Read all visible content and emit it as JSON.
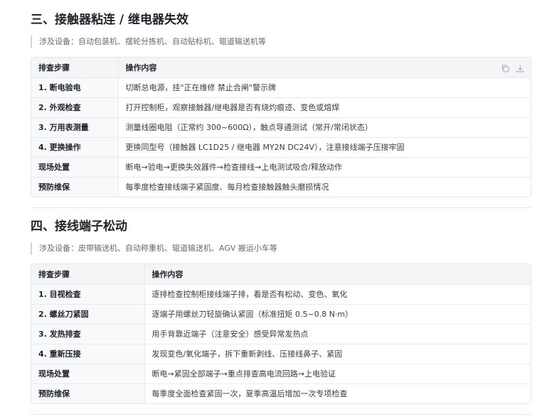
{
  "sections": [
    {
      "title": "三、接触器粘连 / 继电器失效",
      "equipment": "涉及设备：自动包装机、摆轮分拣机、自动贴标机、辊道输送机等",
      "headers": [
        "排查步骤",
        "操作内容"
      ],
      "rows": [
        {
          "step": "1. 断电验电",
          "content": "切断总电源，挂\"正在维修 禁止合闸\"警示牌"
        },
        {
          "step": "2. 外观检查",
          "content": "打开控制柜，观察接触器/继电器是否有烧灼痕迹、变色或熔焊"
        },
        {
          "step": "3. 万用表测量",
          "content": "测量线圈电阻（正常约 300~600Ω），触点导通测试（常开/常闭状态）"
        },
        {
          "step": "4. 更换操作",
          "content": "更换同型号（接触器 LC1D25 / 继电器 MY2N DC24V），注意接线端子压接牢固"
        },
        {
          "step": "现场处置",
          "content": "断电→验电→更换失效器件→检查接线→上电测试吸合/释放动作"
        },
        {
          "step": "预防维保",
          "content": "每季度检查接线端子紧固度、每月检查接触器触头磨损情况"
        }
      ]
    },
    {
      "title": "四、接线端子松动",
      "equipment": "涉及设备：皮带输送机、自动称重机、辊道输送机、AGV 搬运小车等",
      "headers": [
        "排查步骤",
        "操作内容"
      ],
      "rows": [
        {
          "step": "1. 目视检查",
          "content": "逐排检查控制柜接线端子排，看是否有松动、变色、氧化"
        },
        {
          "step": "2. 螺丝刀紧固",
          "content": "逐端子用螺丝刀轻旋确认紧固（标准扭矩 0.5~0.8 N·m）"
        },
        {
          "step": "3. 发热排查",
          "content": "用手背靠近端子（注意安全）感受异常发热点"
        },
        {
          "step": "4. 重新压接",
          "content": "发现变色/氧化端子，拆下重新剥线、压接线鼻子、紧固"
        },
        {
          "step": "现场处置",
          "content": "断电→紧固全部端子→重点排查高电流回路→上电验证"
        },
        {
          "step": "预防维保",
          "content": "每季度全面检查紧固一次，夏季高温后增加一次专项检查"
        }
      ]
    }
  ],
  "icons": {
    "copy": "copy-icon",
    "download": "download-icon"
  },
  "colors": {
    "header_bg": "#f4f5f7",
    "border": "#e4e7eb",
    "accent_bar": "#d0d5dd",
    "muted_text": "#646a73"
  }
}
